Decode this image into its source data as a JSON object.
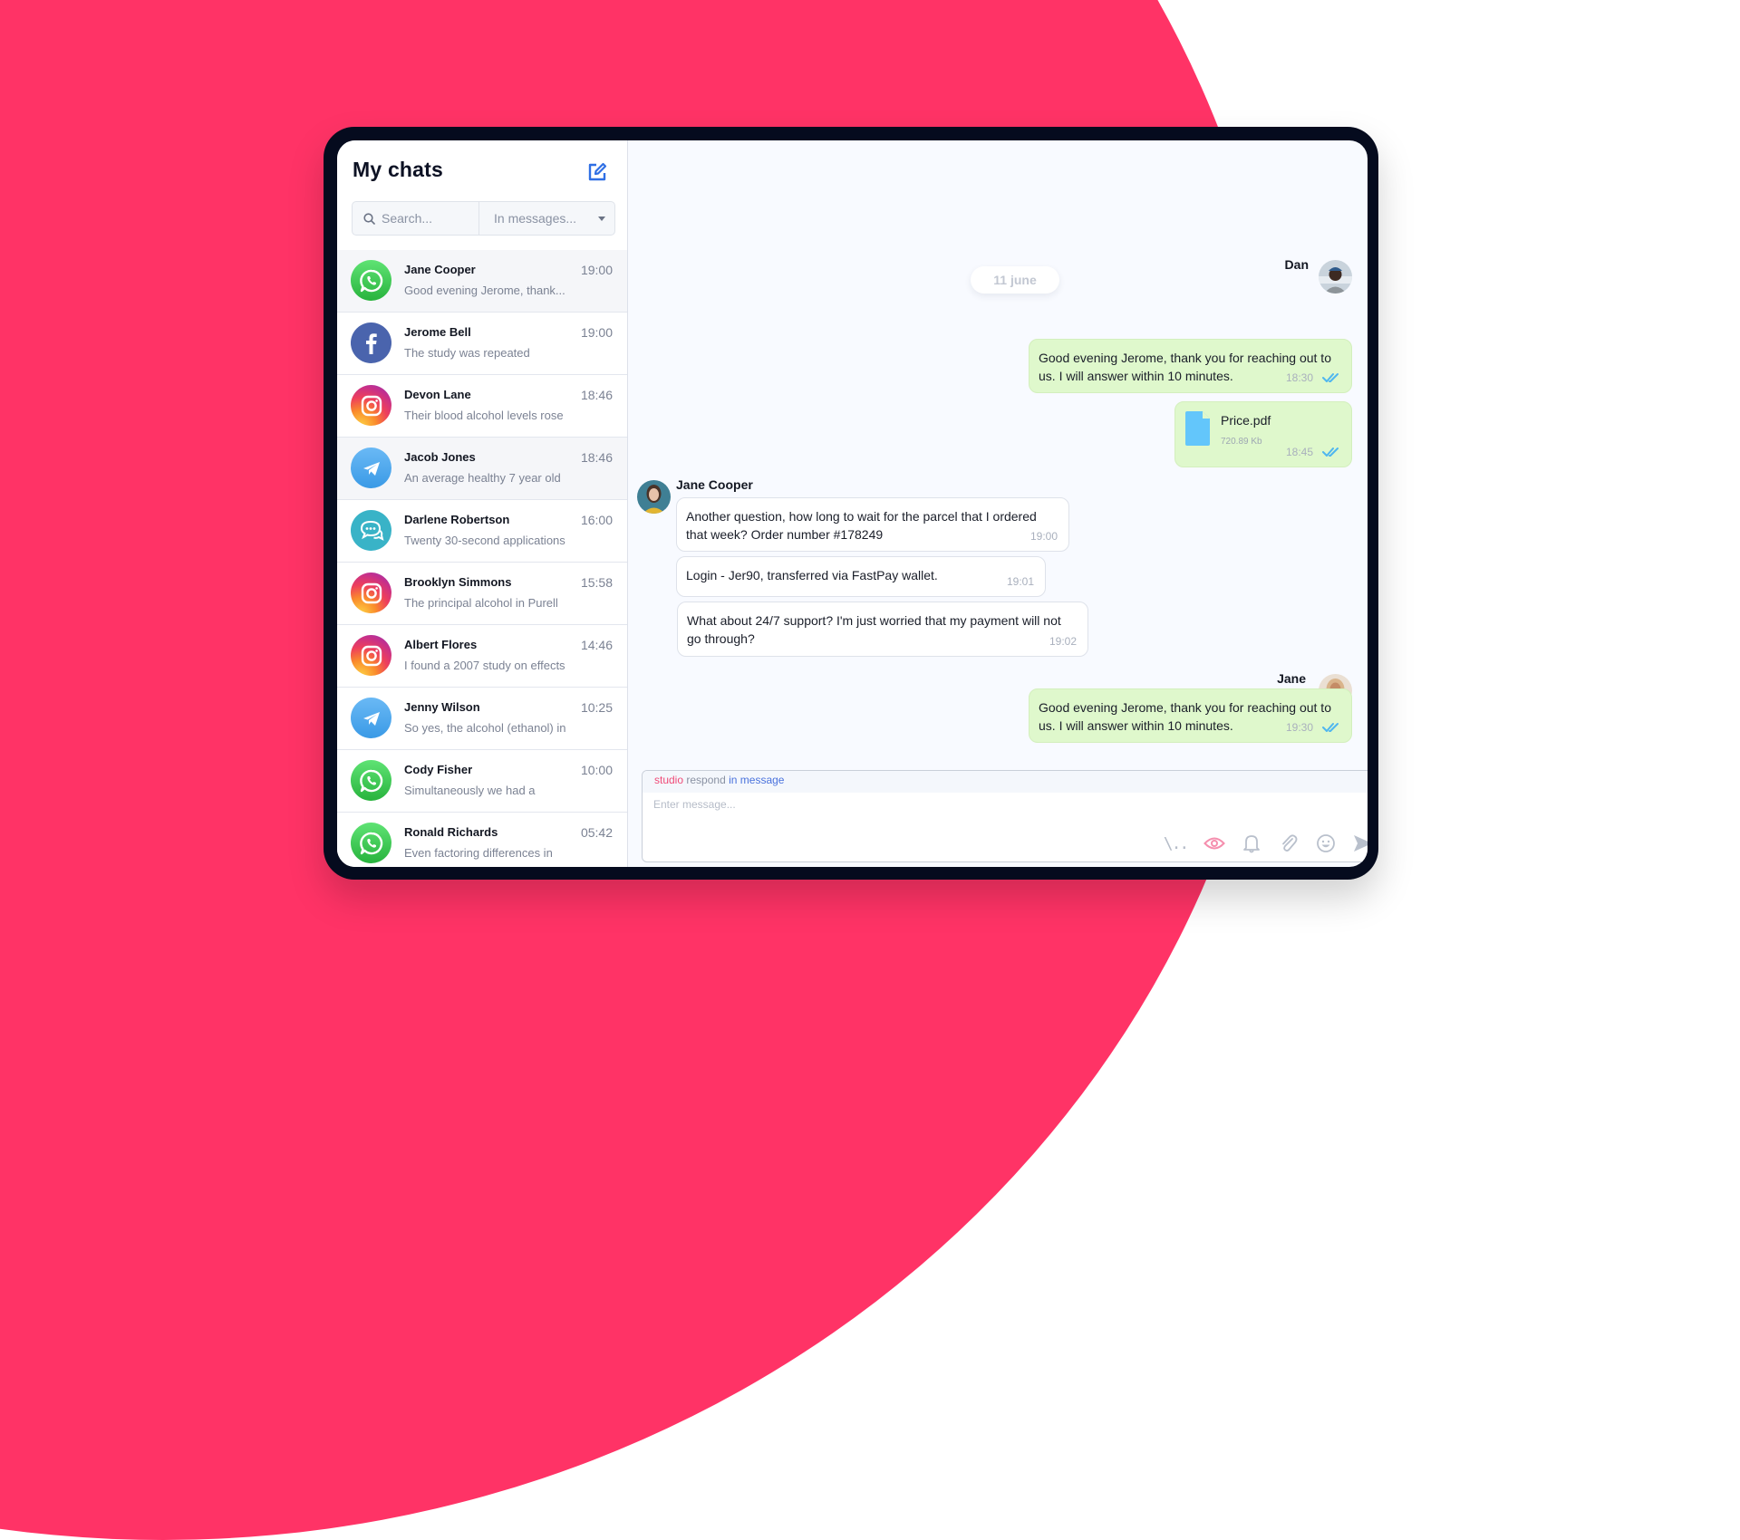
{
  "sidebar": {
    "title": "My chats",
    "new_chat_icon": "edit-square-icon",
    "search": {
      "placeholder": "Search...",
      "value": "",
      "scope_selected": "In messages..."
    },
    "chats": [
      {
        "name": "Jane Cooper",
        "time": "19:00",
        "preview": "Good evening Jerome, thank...",
        "channel": "whatsapp",
        "active": true
      },
      {
        "name": "Jerome Bell",
        "time": "19:00",
        "preview": "The study was repeated",
        "channel": "facebook",
        "active": false
      },
      {
        "name": "Devon Lane",
        "time": "18:46",
        "preview": "Their blood alcohol levels rose",
        "channel": "instagram",
        "active": false
      },
      {
        "name": "Jacob Jones",
        "time": "18:46",
        "preview": "An average healthy 7 year old",
        "channel": "telegram",
        "active": true
      },
      {
        "name": "Darlene Robertson",
        "time": "16:00",
        "preview": "Twenty 30-second applications",
        "channel": "chat",
        "active": false
      },
      {
        "name": "Brooklyn Simmons",
        "time": "15:58",
        "preview": "The principal alcohol in Purell",
        "channel": "instagram",
        "active": false
      },
      {
        "name": "Albert Flores",
        "time": "14:46",
        "preview": "I found a 2007 study on effects",
        "channel": "instagram",
        "active": false
      },
      {
        "name": "Jenny Wilson",
        "time": "10:25",
        "preview": "So yes, the alcohol (ethanol) in",
        "channel": "telegram",
        "active": false
      },
      {
        "name": "Cody Fisher",
        "time": "10:00",
        "preview": "Simultaneously we had a",
        "channel": "whatsapp",
        "active": false
      },
      {
        "name": "Ronald Richards",
        "time": "05:42",
        "preview": "Even factoring differences in",
        "channel": "whatsapp",
        "active": false
      }
    ]
  },
  "conversation": {
    "date_divider": "11 june",
    "groups": [
      {
        "sender": "Dan",
        "direction": "outgoing",
        "messages": [
          {
            "type": "text",
            "text": "Good evening Jerome, thank you for reaching out to us. I will answer within 10 minutes.",
            "time": "18:30",
            "status": "read"
          },
          {
            "type": "file",
            "file_name": "Price.pdf",
            "file_size": "720.89 Kb",
            "time": "18:45",
            "status": "read"
          }
        ]
      },
      {
        "sender": "Jane Cooper",
        "direction": "incoming",
        "messages": [
          {
            "type": "text",
            "text": "Another question, how long to wait for the parcel that I ordered that week? Order number #178249",
            "time": "19:00"
          },
          {
            "type": "text",
            "text": "Login - Jer90, transferred via FastPay wallet.",
            "time": "19:01"
          },
          {
            "type": "text",
            "text": "What about 24/7 support? I'm just worried that my payment will not go through?",
            "time": "19:02"
          }
        ]
      },
      {
        "sender": "Jane",
        "direction": "outgoing",
        "messages": [
          {
            "type": "text",
            "text": "Good evening Jerome, thank you for reaching out to us. I will answer within 10 minutes.",
            "time": "19:30",
            "status": "read"
          }
        ]
      }
    ]
  },
  "composer": {
    "tag_studio": "studio",
    "tag_respond": "respond",
    "tag_in_message": "in message",
    "placeholder": "Enter message...",
    "value": "",
    "command_label": "\\..",
    "tools": [
      "command-icon",
      "eye-icon",
      "bell-icon",
      "paperclip-icon",
      "smiley-icon",
      "send-icon"
    ]
  },
  "colors": {
    "brand_pink": "#ff3366",
    "accent_blue": "#2f6fe4",
    "outgoing_bubble": "#dff8cc",
    "read_ticks": "#4fb6ef"
  }
}
